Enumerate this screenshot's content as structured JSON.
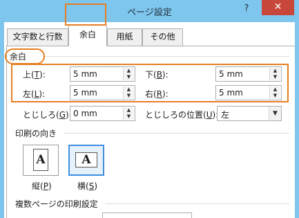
{
  "window": {
    "title": "ページ設定",
    "help_label": "?",
    "close_label": "✕"
  },
  "tabs": [
    {
      "label": "文字数と行数",
      "active": false
    },
    {
      "label": "余白",
      "active": true
    },
    {
      "label": "用紙",
      "active": false
    },
    {
      "label": "その他",
      "active": false
    }
  ],
  "margins": {
    "section_label": "余白",
    "top": {
      "label_pre": "上(",
      "key": "T",
      "label_post": "):",
      "value": "5 mm"
    },
    "bottom": {
      "label_pre": "下(",
      "key": "B",
      "label_post": "):",
      "value": "5 mm"
    },
    "left": {
      "label_pre": "左(",
      "key": "L",
      "label_post": "):",
      "value": "5 mm"
    },
    "right": {
      "label_pre": "右(",
      "key": "R",
      "label_post": "):",
      "value": "5 mm"
    },
    "gutter": {
      "label_pre": "とじしろ(",
      "key": "G",
      "label_post": "):",
      "value": "0 mm"
    },
    "gutter_position": {
      "label_pre": "とじしろの位置(",
      "key": "U",
      "label_post": "):",
      "value": "左"
    }
  },
  "orientation": {
    "section_label": "印刷の向き",
    "portrait": {
      "label_pre": "縦(",
      "key": "P",
      "label_post": ")",
      "glyph": "A",
      "selected": false
    },
    "landscape": {
      "label_pre": "横(",
      "key": "S",
      "label_post": ")",
      "glyph": "A",
      "selected": true
    }
  },
  "multiple_pages": {
    "section_label": "複数ページの印刷設定"
  },
  "colors": {
    "highlight": "#e67e22",
    "titlebar": "#7fc6ee",
    "close": "#c7483b",
    "selected_border": "#3d8ee0"
  }
}
